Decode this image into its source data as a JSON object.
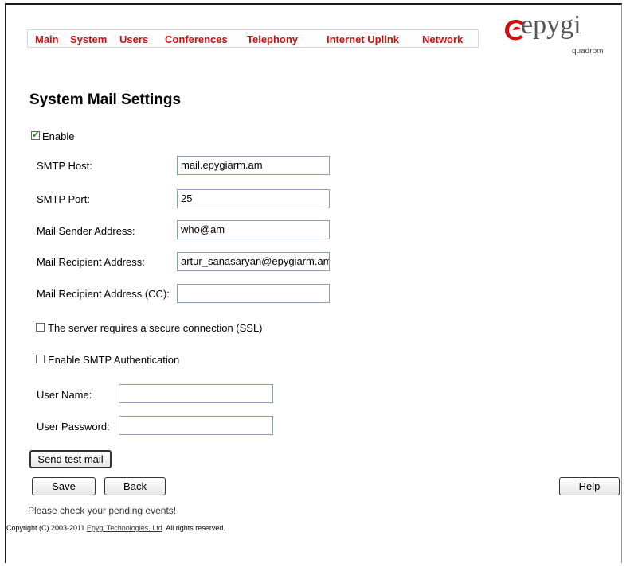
{
  "nav": {
    "items": [
      "Main",
      "System",
      "Users",
      "Conferences",
      "Telephony",
      "Internet Uplink",
      "Network"
    ]
  },
  "logo": {
    "brand": "epygi",
    "sub": "quadrom",
    "color": "#cc1111"
  },
  "page": {
    "title": "System Mail Settings"
  },
  "form": {
    "enable": {
      "label": "Enable",
      "checked": true
    },
    "smtp_host": {
      "label": "SMTP Host:",
      "value": "mail.epygiarm.am"
    },
    "smtp_port": {
      "label": "SMTP Port:",
      "value": "25"
    },
    "sender": {
      "label": "Mail Sender Address:",
      "value": "who@am"
    },
    "recipient": {
      "label": "Mail Recipient Address:",
      "value": "artur_sanasaryan@epygiarm.am"
    },
    "recipient_cc": {
      "label": "Mail Recipient Address (CC):",
      "value": ""
    },
    "ssl": {
      "label": "The server requires a secure connection (SSL)",
      "checked": false
    },
    "smtp_auth": {
      "label": "Enable SMTP Authentication",
      "checked": false
    },
    "user_name": {
      "label": "User Name:",
      "value": ""
    },
    "user_password": {
      "label": "User Password:",
      "value": ""
    }
  },
  "buttons": {
    "send_test": "Send test mail",
    "save": "Save",
    "back": "Back",
    "help": "Help"
  },
  "footer": {
    "pending_events": "Please check your pending events!",
    "copyright_prefix": "Copyright (C) 2003-2011 ",
    "company": "Epygi Technologies, Ltd",
    "copyright_suffix": ". All rights reserved."
  }
}
